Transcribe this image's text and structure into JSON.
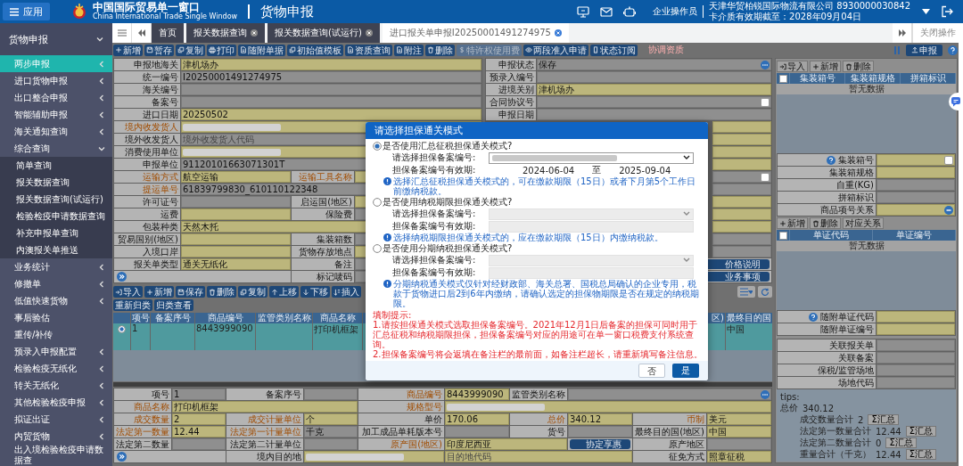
{
  "header": {
    "app_button": "应用",
    "site_title": "中国国际贸易单一窗口",
    "site_subtitle": "China International Trade Single Window",
    "module_title": "货物申报",
    "role": "企业操作员",
    "company": "天津华贸柏锐国际物流有限公司 8930000030842",
    "card_expiry": "卡介质有效期截至：2028年09月04日"
  },
  "sidebar": {
    "title": "货物申报",
    "expanded": true,
    "items": [
      {
        "label": "两步申报",
        "selected": true,
        "has_children": true,
        "expanded": false
      },
      {
        "label": "进口货物申报",
        "selected": false,
        "has_children": true,
        "expanded": false
      },
      {
        "label": "出口整合申报",
        "selected": false,
        "has_children": true,
        "expanded": false
      },
      {
        "label": "智能辅助申报",
        "selected": false,
        "has_children": true,
        "expanded": false
      },
      {
        "label": "海关通知查询",
        "selected": false,
        "has_children": true,
        "expanded": false
      },
      {
        "label": "综合查询",
        "selected": false,
        "has_children": true,
        "expanded": true,
        "children": [
          {
            "label": "简单查询",
            "selected": false
          },
          {
            "label": "报关数据查询",
            "selected": false
          },
          {
            "label": "报关数据查询(试运行)",
            "selected": false
          },
          {
            "label": "检验检疫申请数据查询",
            "selected": false
          },
          {
            "label": "补充申报单查询",
            "selected": false
          },
          {
            "label": "内澳报关单推送",
            "selected": false
          }
        ]
      },
      {
        "label": "业务统计",
        "selected": false,
        "has_children": true,
        "expanded": false
      },
      {
        "label": "修撤单",
        "selected": false,
        "has_children": true,
        "expanded": false
      },
      {
        "label": "低值快速货物",
        "selected": false,
        "has_children": true,
        "expanded": false
      },
      {
        "label": "事后验估",
        "selected": false,
        "has_children": false
      },
      {
        "label": "重传/补传",
        "selected": false,
        "has_children": false
      },
      {
        "label": "预录入申报配置",
        "selected": false,
        "has_children": true,
        "expanded": false
      },
      {
        "label": "检验检疫无纸化",
        "selected": false,
        "has_children": true,
        "expanded": false
      },
      {
        "label": "转关无纸化",
        "selected": false,
        "has_children": true,
        "expanded": false
      },
      {
        "label": "其他检验检疫申报",
        "selected": false,
        "has_children": true,
        "expanded": false
      },
      {
        "label": "拟证出证",
        "selected": false,
        "has_children": true,
        "expanded": false
      },
      {
        "label": "内贸货物",
        "selected": false,
        "has_children": true,
        "expanded": false
      },
      {
        "label": "出入境检验检疫申请数据查",
        "selected": false,
        "has_children": false
      }
    ]
  },
  "tabs": [
    {
      "label": "首页",
      "selected": false,
      "closable": false
    },
    {
      "label": "报关数据查询",
      "selected": false,
      "closable": true
    },
    {
      "label": "报关数据查询(试运行)",
      "selected": false,
      "closable": true
    },
    {
      "label": "进口报关单申报I20250001491274975",
      "selected": true,
      "closable": true
    }
  ],
  "close_operations": "关闭操作",
  "toolbar": {
    "buttons": [
      {
        "label": "新增",
        "disabled": false
      },
      {
        "label": "暂存",
        "disabled": false
      },
      {
        "label": "复制",
        "disabled": false
      },
      {
        "label": "打印",
        "disabled": false
      },
      {
        "label": "随附单据",
        "disabled": false
      },
      {
        "label": "初始值模板",
        "disabled": false
      },
      {
        "label": "资质查询",
        "disabled": false
      },
      {
        "label": "附注",
        "disabled": false
      },
      {
        "label": "删除",
        "disabled": false
      },
      {
        "label": "特许权使用费",
        "disabled": true
      },
      {
        "label": "两段准入申请",
        "disabled": false
      },
      {
        "label": "状态订阅",
        "disabled": false
      }
    ],
    "alert_link": "协调资质",
    "submit_button": "申报"
  },
  "declaration_form": {
    "left_rows": [
      {
        "parts": [
          {
            "kind": "label",
            "text": "申报地海关"
          },
          {
            "kind": "value",
            "text": "津机场办",
            "editable": true
          }
        ]
      },
      {
        "parts": [
          {
            "kind": "label",
            "text": "统一编号"
          },
          {
            "kind": "value",
            "text": "I20250001491274975"
          }
        ]
      },
      {
        "parts": [
          {
            "kind": "label",
            "text": "海关编号"
          },
          {
            "kind": "value"
          }
        ]
      },
      {
        "parts": [
          {
            "kind": "label",
            "text": "备案号"
          },
          {
            "kind": "value"
          }
        ]
      },
      {
        "parts": [
          {
            "kind": "label",
            "text": "进口日期"
          },
          {
            "kind": "value",
            "text": "20250502",
            "editable": true
          }
        ]
      },
      {
        "parts": [
          {
            "kind": "label",
            "text": "境内收发货人",
            "required": true
          },
          {
            "kind": "value",
            "editable": true,
            "redacted": true
          }
        ]
      },
      {
        "parts": [
          {
            "kind": "label",
            "text": "境外收发货人"
          },
          {
            "kind": "value",
            "placeholder": "境外收发货人代码"
          }
        ]
      },
      {
        "parts": [
          {
            "kind": "label",
            "text": "消费使用单位"
          },
          {
            "kind": "value",
            "editable": true,
            "redacted": true
          }
        ]
      },
      {
        "parts": [
          {
            "kind": "label",
            "text": "申报单位"
          },
          {
            "kind": "value",
            "text": "91120101663071301T"
          }
        ]
      },
      {
        "parts": [
          {
            "kind": "label",
            "text": "运输方式",
            "required": true
          },
          {
            "kind": "value",
            "text": "航空运输",
            "editable": true
          },
          {
            "kind": "label",
            "text": "运输工具名称",
            "required": true
          },
          {
            "kind": "value",
            "editable": true
          }
        ]
      },
      {
        "parts": [
          {
            "kind": "label",
            "text": "提运单号",
            "required": true
          },
          {
            "kind": "value",
            "text": "61839799830_610110122348"
          }
        ]
      },
      {
        "parts": [
          {
            "kind": "label",
            "text": "许可证号"
          },
          {
            "kind": "value"
          },
          {
            "kind": "label",
            "text": "启运国(地区)"
          },
          {
            "kind": "value",
            "editable": true
          }
        ]
      },
      {
        "parts": [
          {
            "kind": "label",
            "text": "运费"
          },
          {
            "kind": "value",
            "editable": true
          },
          {
            "kind": "label",
            "text": "保险费"
          },
          {
            "kind": "value"
          }
        ]
      },
      {
        "parts": [
          {
            "kind": "label",
            "text": "包装种类"
          },
          {
            "kind": "value",
            "text": "天然木托",
            "editable": true
          }
        ]
      },
      {
        "parts": [
          {
            "kind": "label",
            "text": "贸易国别(地区)"
          },
          {
            "kind": "value",
            "editable": true
          },
          {
            "kind": "label",
            "text": "集装箱数"
          },
          {
            "kind": "value"
          }
        ]
      },
      {
        "parts": [
          {
            "kind": "label",
            "text": "入境口岸"
          },
          {
            "kind": "value",
            "editable": true
          },
          {
            "kind": "label",
            "text": "货物存放地点"
          },
          {
            "kind": "value",
            "editable": true
          }
        ]
      },
      {
        "parts": [
          {
            "kind": "label",
            "text": "报关单类型"
          },
          {
            "kind": "value",
            "text": "通关无纸化",
            "editable": true
          },
          {
            "kind": "label",
            "text": "备注"
          },
          {
            "kind": "value"
          }
        ]
      },
      {
        "parts": [
          {
            "kind": "icon"
          },
          {
            "kind": "label",
            "text": "标记唛码"
          },
          {
            "kind": "value"
          }
        ]
      }
    ],
    "right_rows": [
      {
        "parts": [
          {
            "kind": "label",
            "text": "申报状态"
          },
          {
            "kind": "value_more",
            "text": "保存"
          }
        ]
      },
      {
        "parts": [
          {
            "kind": "label",
            "text": "预录入编号"
          },
          {
            "kind": "value"
          }
        ]
      },
      {
        "parts": [
          {
            "kind": "label",
            "text": "进境关别"
          },
          {
            "kind": "value",
            "text": "津机场办",
            "editable": true
          }
        ]
      },
      {
        "parts": [
          {
            "kind": "label",
            "text": "合同协议号"
          },
          {
            "kind": "value_check"
          }
        ]
      },
      {
        "parts": [
          {
            "kind": "label",
            "text": "申报日期"
          },
          {
            "kind": "value"
          }
        ]
      },
      {
        "parts": [
          {
            "kind": "value",
            "editable": true
          }
        ]
      },
      {
        "parts": [
          {
            "kind": "value",
            "editable": true
          }
        ]
      },
      {
        "parts": [
          {
            "kind": "value",
            "editable": true
          }
        ]
      },
      {
        "parts": [
          {
            "kind": "value",
            "editable": true
          }
        ]
      },
      {
        "parts": [
          {
            "kind": "value_check"
          }
        ]
      },
      {
        "parts": [
          {
            "kind": "value"
          }
        ]
      },
      {
        "parts": [
          {
            "kind": "value",
            "editable": true
          }
        ]
      },
      {
        "parts": [
          {
            "kind": "value",
            "editable": true
          }
        ]
      },
      {
        "parts": [
          {
            "kind": "value",
            "editable": true
          }
        ]
      },
      {
        "parts": [
          {
            "kind": "value"
          }
        ]
      },
      {
        "parts": [
          {
            "kind": "value"
          }
        ]
      },
      {
        "parts": [
          {
            "kind": "button",
            "text": "价格说明"
          }
        ]
      },
      {
        "parts": [
          {
            "kind": "button",
            "text": "业务事项"
          }
        ]
      }
    ]
  },
  "goods": {
    "toolbar": [
      "导入",
      "新增",
      "保存",
      "删除",
      "复制",
      "上移",
      "下移",
      "插入",
      "重新归类",
      "归类查看"
    ],
    "columns": [
      "项号",
      "备案序号",
      "商品编号",
      "监管类别名称",
      "商品名称",
      null,
      "区)",
      "最终目的国"
    ],
    "rows": [
      {
        "selected": true,
        "cells": [
          "1",
          null,
          "8443999090",
          null,
          "打印机框架",
          null,
          null,
          "中国"
        ]
      }
    ],
    "detail_rows": [
      {
        "parts": [
          {
            "kind": "label",
            "text": "项号"
          },
          {
            "kind": "value",
            "text": "1"
          },
          {
            "kind": "label",
            "text": "备案序号"
          },
          {
            "kind": "value"
          },
          {
            "kind": "label",
            "text": "商品编号",
            "required": true
          },
          {
            "kind": "value",
            "text": "8443999090",
            "editable": true
          },
          {
            "kind": "label",
            "text": "监管类别名称"
          },
          {
            "kind": "value_more"
          }
        ]
      },
      {
        "parts": [
          {
            "kind": "label",
            "text": "商品名称",
            "required": true
          },
          {
            "kind": "value",
            "text": "打印机框架",
            "editable": true
          },
          {
            "kind": "label",
            "text": "规格型号",
            "required": true
          },
          {
            "kind": "value",
            "editable": true,
            "redacted": true
          }
        ]
      },
      {
        "parts": [
          {
            "kind": "label",
            "text": "成交数量",
            "required": true
          },
          {
            "kind": "value",
            "text": "2",
            "editable": true
          },
          {
            "kind": "label",
            "text": "成交计量单位",
            "required": true
          },
          {
            "kind": "value",
            "text": "个",
            "editable": true
          },
          {
            "kind": "label",
            "text": "单价"
          },
          {
            "kind": "value",
            "text": "170.06",
            "editable": true
          },
          {
            "kind": "label",
            "text": "总价",
            "required": true
          },
          {
            "kind": "value",
            "text": "340.12",
            "editable": true
          },
          {
            "kind": "label",
            "text": "币制",
            "required": true
          },
          {
            "kind": "value",
            "text": "美元",
            "editable": true
          }
        ]
      },
      {
        "parts": [
          {
            "kind": "label",
            "text": "法定第一数量",
            "required": true
          },
          {
            "kind": "value",
            "text": "12.44",
            "editable": true
          },
          {
            "kind": "label",
            "text": "法定第一计量单位",
            "required": true
          },
          {
            "kind": "value",
            "text": "千克"
          },
          {
            "kind": "label",
            "text": "加工成品单耗版本号"
          },
          {
            "kind": "value"
          },
          {
            "kind": "label",
            "text": "货号"
          },
          {
            "kind": "value"
          },
          {
            "kind": "label",
            "text": "最终目的国(地区)"
          },
          {
            "kind": "value",
            "text": "中国",
            "editable": true
          }
        ]
      },
      {
        "parts": [
          {
            "kind": "label",
            "text": "法定第二数量"
          },
          {
            "kind": "value"
          },
          {
            "kind": "label",
            "text": "法定第二计量单位"
          },
          {
            "kind": "value"
          },
          {
            "kind": "label",
            "text": "原产国(地区)",
            "required": true
          },
          {
            "kind": "value",
            "text": "印度尼西亚",
            "editable": true
          },
          {
            "kind": "button",
            "text": "协定享惠"
          },
          {
            "kind": "label",
            "text": "原产地区"
          },
          {
            "kind": "value"
          }
        ]
      },
      {
        "parts": [
          {
            "kind": "icon"
          },
          {
            "kind": "label",
            "text": "境内目的地"
          },
          {
            "kind": "value",
            "editable": true,
            "redacted": true
          },
          {
            "kind": "value",
            "placeholder": "目的地代码",
            "editable": true
          },
          {
            "kind": "label",
            "text": "征免方式"
          },
          {
            "kind": "value",
            "text": "照章征税",
            "editable": true
          }
        ]
      }
    ]
  },
  "side_panel": {
    "containers": {
      "toolbar": [
        "导入",
        "新增",
        "删除"
      ],
      "columns": [
        "集装箱号",
        "集装箱规格",
        "拼箱标识"
      ],
      "empty_text": "暂无数据",
      "fields": [
        {
          "parts": [
            {
              "kind": "label_help",
              "text": "集装箱号"
            },
            {
              "kind": "value_check",
              "editable": true
            }
          ]
        },
        {
          "parts": [
            {
              "kind": "label",
              "text": "集装箱规格"
            },
            {
              "kind": "value",
              "editable": true
            }
          ]
        },
        {
          "parts": [
            {
              "kind": "label",
              "text": "自重(KG)"
            },
            {
              "kind": "value"
            }
          ]
        },
        {
          "parts": [
            {
              "kind": "label",
              "text": "拼箱标识"
            },
            {
              "kind": "value"
            }
          ]
        },
        {
          "parts": [
            {
              "kind": "label",
              "text": "商品项号关系"
            },
            {
              "kind": "value_remove",
              "editable": true
            }
          ]
        }
      ]
    },
    "documents": {
      "toolbar": [
        "新增",
        "删除",
        "对应关系"
      ],
      "columns": [
        "单证代码",
        "单证编号"
      ],
      "empty_text": "暂无数据",
      "fields": [
        {
          "parts": [
            {
              "kind": "label_help",
              "text": "随附单证代码"
            },
            {
              "kind": "value",
              "editable": true
            }
          ]
        },
        {
          "parts": [
            {
              "kind": "label",
              "text": "随附单证编号"
            },
            {
              "kind": "value",
              "editable": true
            }
          ]
        }
      ]
    },
    "links": [
      {
        "parts": [
          {
            "kind": "label",
            "text": "关联报关单"
          },
          {
            "kind": "value"
          }
        ]
      },
      {
        "parts": [
          {
            "kind": "label",
            "text": "关联备案"
          },
          {
            "kind": "value"
          }
        ]
      },
      {
        "parts": [
          {
            "kind": "label",
            "text": "保税/监管场地"
          },
          {
            "kind": "value"
          }
        ]
      },
      {
        "parts": [
          {
            "kind": "label",
            "text": "场地代码"
          },
          {
            "kind": "value"
          }
        ]
      }
    ],
    "tips": {
      "title": "tips:",
      "items": [
        {
          "label": "总价",
          "value": "340.12"
        },
        {
          "label": "成交数量合计",
          "value": "2",
          "button": "Σ汇总"
        },
        {
          "label": "法定第一数量合计",
          "value": "12.44",
          "button": "Σ汇总"
        },
        {
          "label": "法定第二数量合计",
          "value": "0",
          "button": "Σ汇总"
        },
        {
          "label": "重量合计（千克）",
          "value": "12.44",
          "button": "Σ汇总"
        }
      ]
    }
  },
  "dialog": {
    "title": "请选择担保通关模式",
    "modes": [
      {
        "label": "是否使用汇总征税担保通关模式?",
        "selected": true,
        "select_label": "请选择担保备案编号:",
        "select_disabled": false,
        "select_redacted": true,
        "validity_label": "担保备案编号有效期:",
        "valid_from": "2024-06-04",
        "valid_separator": "至",
        "valid_to": "2025-09-04",
        "note": "选择汇总征税担保通关模式的，可在缴款期限（15日）或者下月第5个工作日前缴纳税款。"
      },
      {
        "label": "是否使用纳税期限担保通关模式?",
        "selected": false,
        "select_label": "请选择担保备案编号:",
        "select_disabled": true,
        "select_redacted": false,
        "validity_label": "担保备案编号有效期:",
        "note": "选择纳税期限担保通关模式的，应在缴款期限（15日）内缴纳税款。"
      },
      {
        "label": "是否使用分期纳税担保通关模式?",
        "selected": false,
        "select_label": "请选择担保备案编号:",
        "select_disabled": true,
        "select_redacted": false,
        "validity_label": "担保备案编号有效期:",
        "note": "分期纳税通关模式仅针对经财政部、海关总署、国税总局确认的企业专用，税款于货物进口后2到6年内缴纳，请确认选定的担保物期限是否在规定的纳税期限。"
      }
    ],
    "tips_title": "填制提示:",
    "tips": [
      "1.请按担保通关模式选取担保备案编号。2021年12月1日后备案的担保可同时用于汇总征税和纳税期限担保，担保备案编号对应的用途可在单一窗口税费支付系统查询。",
      "2.担保备案编号将会返填在备注栏的最前面，如备注栏超长，请重新填写备注信息。"
    ],
    "buttons": [
      {
        "label": "否",
        "kind": "cancel"
      },
      {
        "label": "是",
        "kind": "confirm"
      }
    ]
  }
}
